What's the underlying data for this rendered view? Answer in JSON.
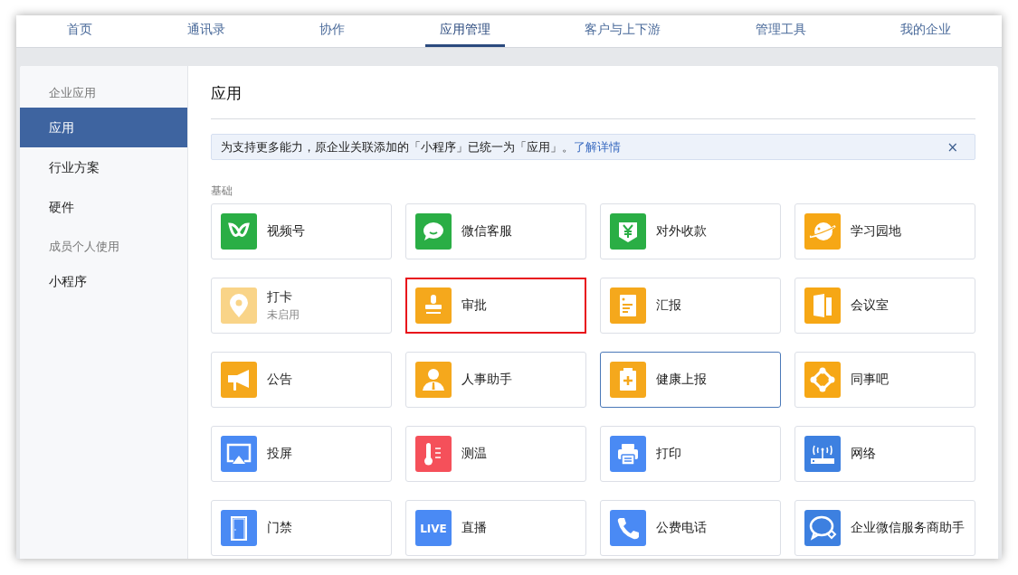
{
  "nav": {
    "tabs": [
      {
        "label": "首页",
        "selected": false
      },
      {
        "label": "通讯录",
        "selected": false
      },
      {
        "label": "协作",
        "selected": false
      },
      {
        "label": "应用管理",
        "selected": true
      },
      {
        "label": "客户与上下游",
        "selected": false
      },
      {
        "label": "管理工具",
        "selected": false
      },
      {
        "label": "我的企业",
        "selected": false
      }
    ]
  },
  "sidebar": {
    "sections": [
      {
        "heading": "企业应用",
        "items": [
          {
            "label": "应用",
            "selected": true
          },
          {
            "label": "行业方案",
            "selected": false
          },
          {
            "label": "硬件",
            "selected": false
          }
        ]
      },
      {
        "heading": "成员个人使用",
        "items": [
          {
            "label": "小程序",
            "selected": false
          }
        ]
      }
    ]
  },
  "content": {
    "title": "应用",
    "notice": {
      "text": "为支持更多能力，原企业关联添加的「小程序」已统一为「应用」。",
      "link": "了解详情",
      "close": "×"
    },
    "section": {
      "heading": "基础",
      "apps": [
        {
          "name": "视频号",
          "kind": "loop",
          "color": "#2aae45",
          "highlighted": false,
          "focused": false
        },
        {
          "name": "微信客服",
          "kind": "chat",
          "color": "#2aae45",
          "highlighted": false,
          "focused": false
        },
        {
          "name": "对外收款",
          "kind": "shield",
          "color": "#2aae45",
          "highlighted": false,
          "focused": false
        },
        {
          "name": "学习园地",
          "kind": "planet",
          "color": "#f6a715",
          "highlighted": false,
          "focused": false
        },
        {
          "name": "打卡",
          "status": "未启用",
          "kind": "pin",
          "color": "#f9d488",
          "highlighted": false,
          "focused": false
        },
        {
          "name": "审批",
          "kind": "stamp",
          "color": "#f5a81c",
          "highlighted": true,
          "focused": false
        },
        {
          "name": "汇报",
          "kind": "report",
          "color": "#f5a81c",
          "highlighted": false,
          "focused": false
        },
        {
          "name": "会议室",
          "kind": "door",
          "color": "#f6a715",
          "highlighted": false,
          "focused": false
        },
        {
          "name": "公告",
          "kind": "megaphone",
          "color": "#f5a81c",
          "highlighted": false,
          "focused": false
        },
        {
          "name": "人事助手",
          "kind": "person",
          "color": "#f5a81c",
          "highlighted": false,
          "focused": false
        },
        {
          "name": "健康上报",
          "kind": "clipboard",
          "color": "#f5a81c",
          "highlighted": false,
          "focused": true
        },
        {
          "name": "同事吧",
          "kind": "nodes",
          "color": "#f6a715",
          "highlighted": false,
          "focused": false
        },
        {
          "name": "投屏",
          "kind": "cast",
          "color": "#4a8af4",
          "highlighted": false,
          "focused": false
        },
        {
          "name": "测温",
          "kind": "thermometer",
          "color": "#f5505a",
          "highlighted": false,
          "focused": false
        },
        {
          "name": "打印",
          "kind": "printer",
          "color": "#4a8af4",
          "highlighted": false,
          "focused": false
        },
        {
          "name": "网络",
          "kind": "router",
          "color": "#3d80e0",
          "highlighted": false,
          "focused": false
        },
        {
          "name": "门禁",
          "kind": "gate",
          "color": "#4a8af4",
          "highlighted": false,
          "focused": false
        },
        {
          "name": "直播",
          "kind": "live",
          "icon_text": "LIVE",
          "color": "#4a8af4",
          "highlighted": false,
          "focused": false
        },
        {
          "name": "公费电话",
          "kind": "phone",
          "color": "#4a8af4",
          "highlighted": false,
          "focused": false
        },
        {
          "name": "企业微信服务商助手",
          "kind": "bubbles",
          "color": "#3d80e0",
          "highlighted": false,
          "focused": false
        }
      ]
    }
  }
}
